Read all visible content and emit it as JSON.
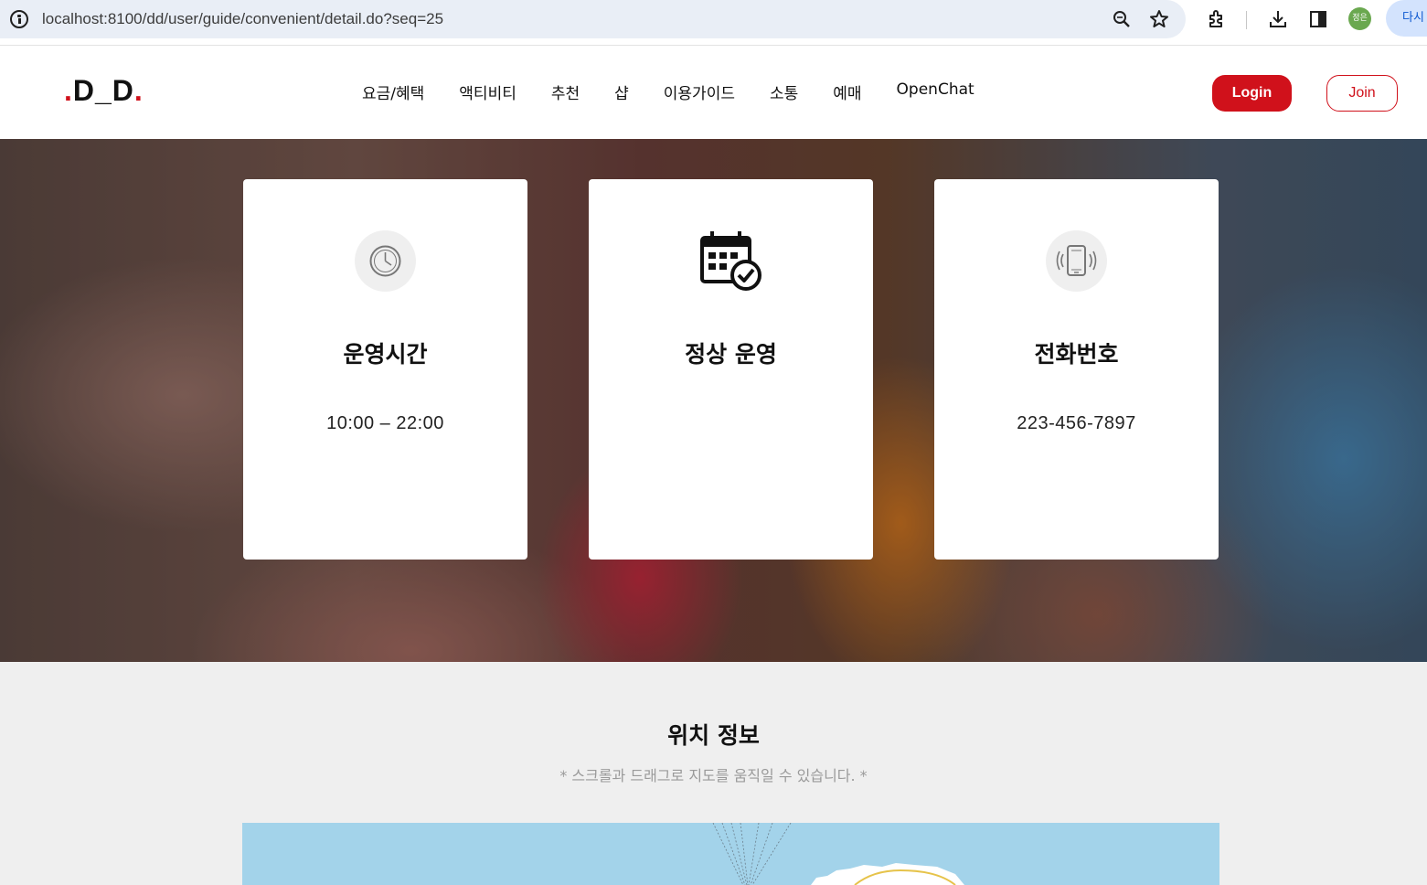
{
  "browser": {
    "url": "localhost:8100/dd/user/guide/convenient/detail.do?seq=25",
    "profile_label": "정은",
    "resume_label": "다시"
  },
  "header": {
    "logo_pre": ".",
    "logo_text": "D_D",
    "logo_post": ".",
    "nav": [
      "요금/혜택",
      "액티비티",
      "추천",
      "샵",
      "이용가이드",
      "소통",
      "예매",
      "OpenChat"
    ],
    "login_label": "Login",
    "join_label": "Join"
  },
  "cards": [
    {
      "title": "운영시간",
      "value": "10:00 – 22:00",
      "icon": "clock-icon"
    },
    {
      "title": "정상 운영",
      "value": "",
      "icon": "calendar-check-icon"
    },
    {
      "title": "전화번호",
      "value": "223-456-7897",
      "icon": "phone-vibrate-icon"
    }
  ],
  "location": {
    "title": "위치 정보",
    "hint": "* 스크롤과 드래그로 지도를 움직일 수 있습니다. *"
  },
  "colors": {
    "brand_red": "#d0111b",
    "map_water": "#a3d3ea",
    "section_bg": "#efefef"
  }
}
